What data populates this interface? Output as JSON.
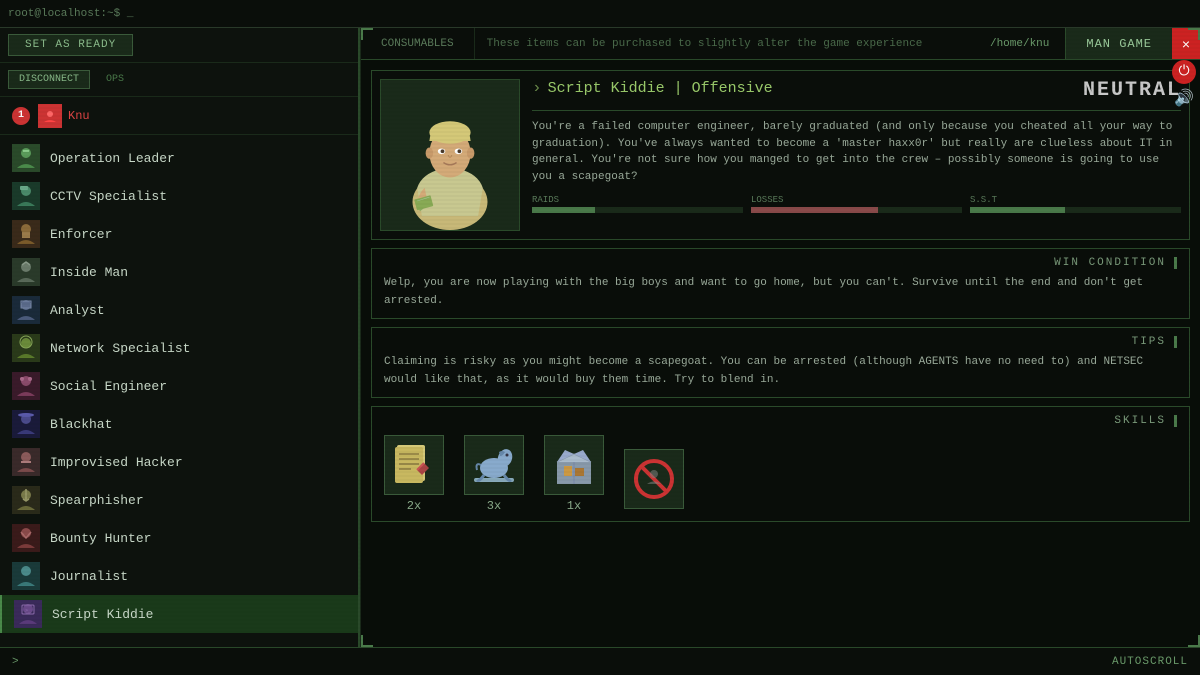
{
  "app": {
    "title": "root@localhost:~$ _",
    "path": "/home/knu",
    "manGameLabel": "MAN GAME",
    "closeLabel": "×",
    "powerIcon": "⏻",
    "soundIcon": "🔊"
  },
  "topBar": {
    "tabConsumables": "CONSUMABLES",
    "tabDesc": "These items can be purchased to slightly alter the game experience",
    "setReadyLabel": "SET AS READY"
  },
  "playerInfo": {
    "badge": "1",
    "name": "Knu",
    "disconnectLabel": "DISCONNECT",
    "opsLabel": "OPS"
  },
  "characters": [
    {
      "id": "op-leader",
      "name": "Operation Leader",
      "avatarColor": "#3a6a3a",
      "avatarIcon": "👤"
    },
    {
      "id": "cctv",
      "name": "CCTV Specialist",
      "avatarColor": "#2a5a4a",
      "avatarIcon": "📷"
    },
    {
      "id": "enforcer",
      "name": "Enforcer",
      "avatarColor": "#5a3a1a",
      "avatarIcon": "💪"
    },
    {
      "id": "inside-man",
      "name": "Inside Man",
      "avatarColor": "#3a4a3a",
      "avatarIcon": "🕵"
    },
    {
      "id": "analyst",
      "name": "Analyst",
      "avatarColor": "#2a3a5a",
      "avatarIcon": "📊"
    },
    {
      "id": "network",
      "name": "Network Specialist",
      "avatarColor": "#3a5a2a",
      "avatarIcon": "🌐"
    },
    {
      "id": "social",
      "name": "Social Engineer",
      "avatarColor": "#5a2a3a",
      "avatarIcon": "🗣"
    },
    {
      "id": "blackhat",
      "name": "Blackhat",
      "avatarColor": "#2a2a5a",
      "avatarIcon": "🎩"
    },
    {
      "id": "improv",
      "name": "Improvised Hacker",
      "avatarColor": "#5a3a3a",
      "avatarIcon": "🔧"
    },
    {
      "id": "spearphish",
      "name": "Spearphisher",
      "avatarColor": "#3a3a2a",
      "avatarIcon": "🎣"
    },
    {
      "id": "bounty",
      "name": "Bounty Hunter",
      "avatarColor": "#5a2a2a",
      "avatarIcon": "🏹"
    },
    {
      "id": "journalist",
      "name": "Journalist",
      "avatarColor": "#2a5a5a",
      "avatarIcon": "📰"
    },
    {
      "id": "script",
      "name": "Script Kiddie",
      "avatarColor": "#3a2a5a",
      "avatarIcon": "💻"
    }
  ],
  "selectedCharacter": {
    "rolePrefix": "› Script Kiddie |",
    "roleType": "Offensive",
    "alignment": "NEUTRAL",
    "description": "You're a failed computer engineer, barely graduated (and only because you cheated all your way to graduation). You've always wanted to become a 'master haxx0r' but really are clueless about IT in general. You're not sure how you manged to get into the crew – possibly someone is going to use you a scapegoat?",
    "winConditionHeader": "WIN CONDITION",
    "winConditionText": "Welp, you are now playing with the big boys and want to go home, but you can't. Survive until the end and don't get arrested.",
    "tipsHeader": "TIPS",
    "tipsText": "Claiming is risky as you might become a scapegoat. You can be arrested (although AGENTS have no need to) and NETSEC would like that, as it would buy them time. Try to blend in.",
    "skillsHeader": "SKILLS",
    "skills": [
      {
        "id": "skill1",
        "icon": "📋",
        "count": "2x"
      },
      {
        "id": "skill2",
        "icon": "🐴",
        "count": "3x"
      },
      {
        "id": "skill3",
        "icon": "📦",
        "count": "1x"
      },
      {
        "id": "skill4",
        "icon": "🚫",
        "count": ""
      }
    ]
  },
  "bottomBar": {
    "prompt": ">",
    "autoscrollLabel": "AUTOSCROLL"
  },
  "colors": {
    "accent": "#4a8a4a",
    "bg": "#080d08",
    "panel": "#0d120d",
    "border": "#2a4a2a",
    "text": "#c8d8c8",
    "muted": "#5a7a5a",
    "highlight": "#9aca9a",
    "red": "#cc2222",
    "neutral": "#c8c8c8"
  }
}
